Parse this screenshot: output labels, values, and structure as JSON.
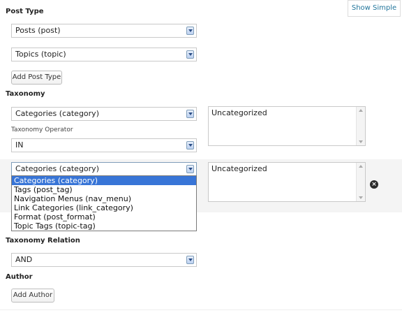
{
  "toolbar": {
    "show_simple_label": "Show Simple"
  },
  "post_type": {
    "label": "Post Type",
    "selects": [
      {
        "value": "Posts (post)"
      },
      {
        "value": "Topics (topic)"
      }
    ],
    "add_button": "Add Post Type"
  },
  "taxonomy": {
    "label": "Taxonomy",
    "row1": {
      "taxonomy_value": "Categories (category)",
      "operator_label": "Taxonomy Operator",
      "operator_value": "IN",
      "terms_value": "Uncategorized"
    },
    "row2": {
      "taxonomy_value": "Categories (category)",
      "terms_value": "Uncategorized",
      "dropdown_options": [
        "Categories (category)",
        "Tags (post_tag)",
        "Navigation Menus (nav_menu)",
        "Link Categories (link_category)",
        "Format (post_format)",
        "Topic Tags (topic-tag)"
      ],
      "selected_option_index": 0,
      "remove_icon": "close-circle-icon"
    }
  },
  "taxonomy_relation": {
    "label": "Taxonomy Relation",
    "value": "AND"
  },
  "author": {
    "label": "Author",
    "add_button": "Add Author"
  },
  "colors": {
    "selected_option": "#3875d7",
    "row_highlight": "#f4f4f4",
    "link_text": "#21759b"
  }
}
